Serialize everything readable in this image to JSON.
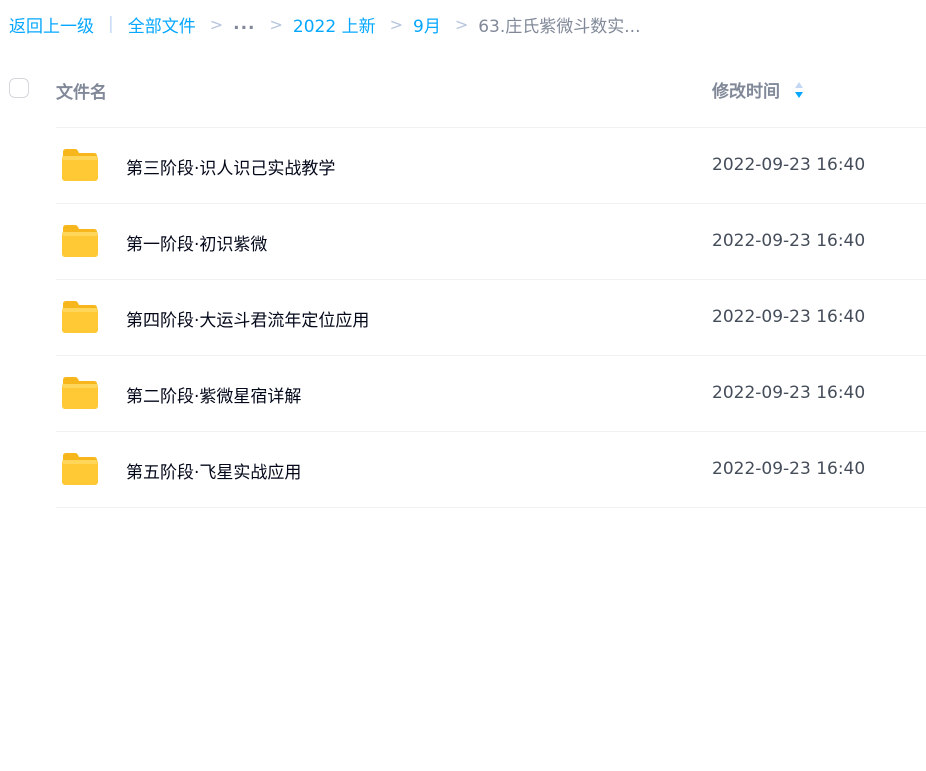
{
  "breadcrumb": {
    "back": "返回上一级",
    "pipe": "|",
    "sep": ">",
    "all_files": "全部文件",
    "ellipsis": "...",
    "level_2022": "2022 上新",
    "level_sep": "9月",
    "current": "63.庄氏紫微斗数实..."
  },
  "table": {
    "col_name": "文件名",
    "col_time": "修改时间",
    "rows": [
      {
        "name": "第三阶段·识人识己实战教学",
        "time": "2022-09-23 16:40"
      },
      {
        "name": "第一阶段·初识紫微",
        "time": "2022-09-23 16:40"
      },
      {
        "name": "第四阶段·大运斗君流年定位应用",
        "time": "2022-09-23 16:40"
      },
      {
        "name": "第二阶段·紫微星宿详解",
        "time": "2022-09-23 16:40"
      },
      {
        "name": "第五阶段·飞星实战应用",
        "time": "2022-09-23 16:40"
      }
    ]
  },
  "colors": {
    "link": "#06a7ff",
    "muted": "#818999",
    "folder": "#ffc935",
    "sort_active": "#06a7ff",
    "sort_inactive": "#c4d8f4"
  },
  "icons": {
    "folder": "folder-icon",
    "sort": "sort-icon"
  }
}
